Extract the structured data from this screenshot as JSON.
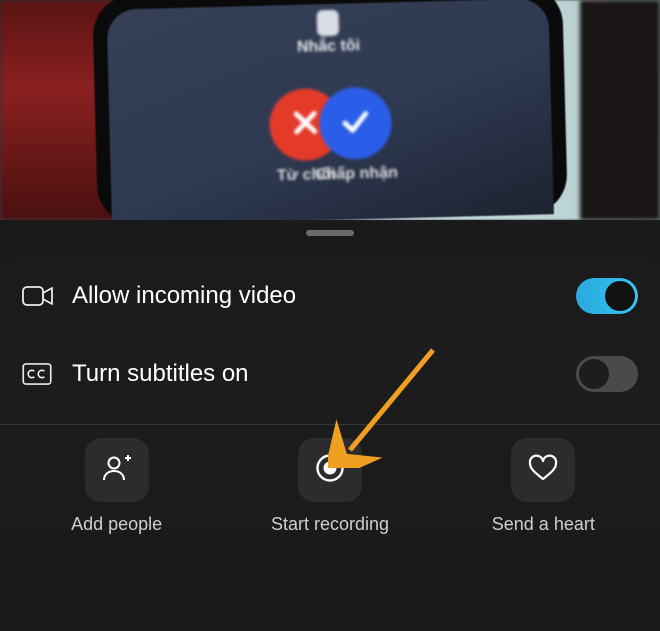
{
  "call_preview": {
    "top_caption": "Nhắc tôi",
    "decline_label": "Từ chối",
    "accept_label": "Chấp nhận"
  },
  "settings": {
    "allow_video": {
      "label": "Allow incoming video",
      "on": true
    },
    "subtitles": {
      "label": "Turn subtitles on",
      "on": false
    }
  },
  "actions": {
    "add_people": {
      "label": "Add people"
    },
    "start_recording": {
      "label": "Start recording"
    },
    "send_heart": {
      "label": "Send a heart"
    }
  },
  "colors": {
    "accent": "#2aa9e0",
    "decline": "#e43a2a",
    "accept": "#2a5ee8",
    "annotation_arrow": "#f0a020"
  }
}
